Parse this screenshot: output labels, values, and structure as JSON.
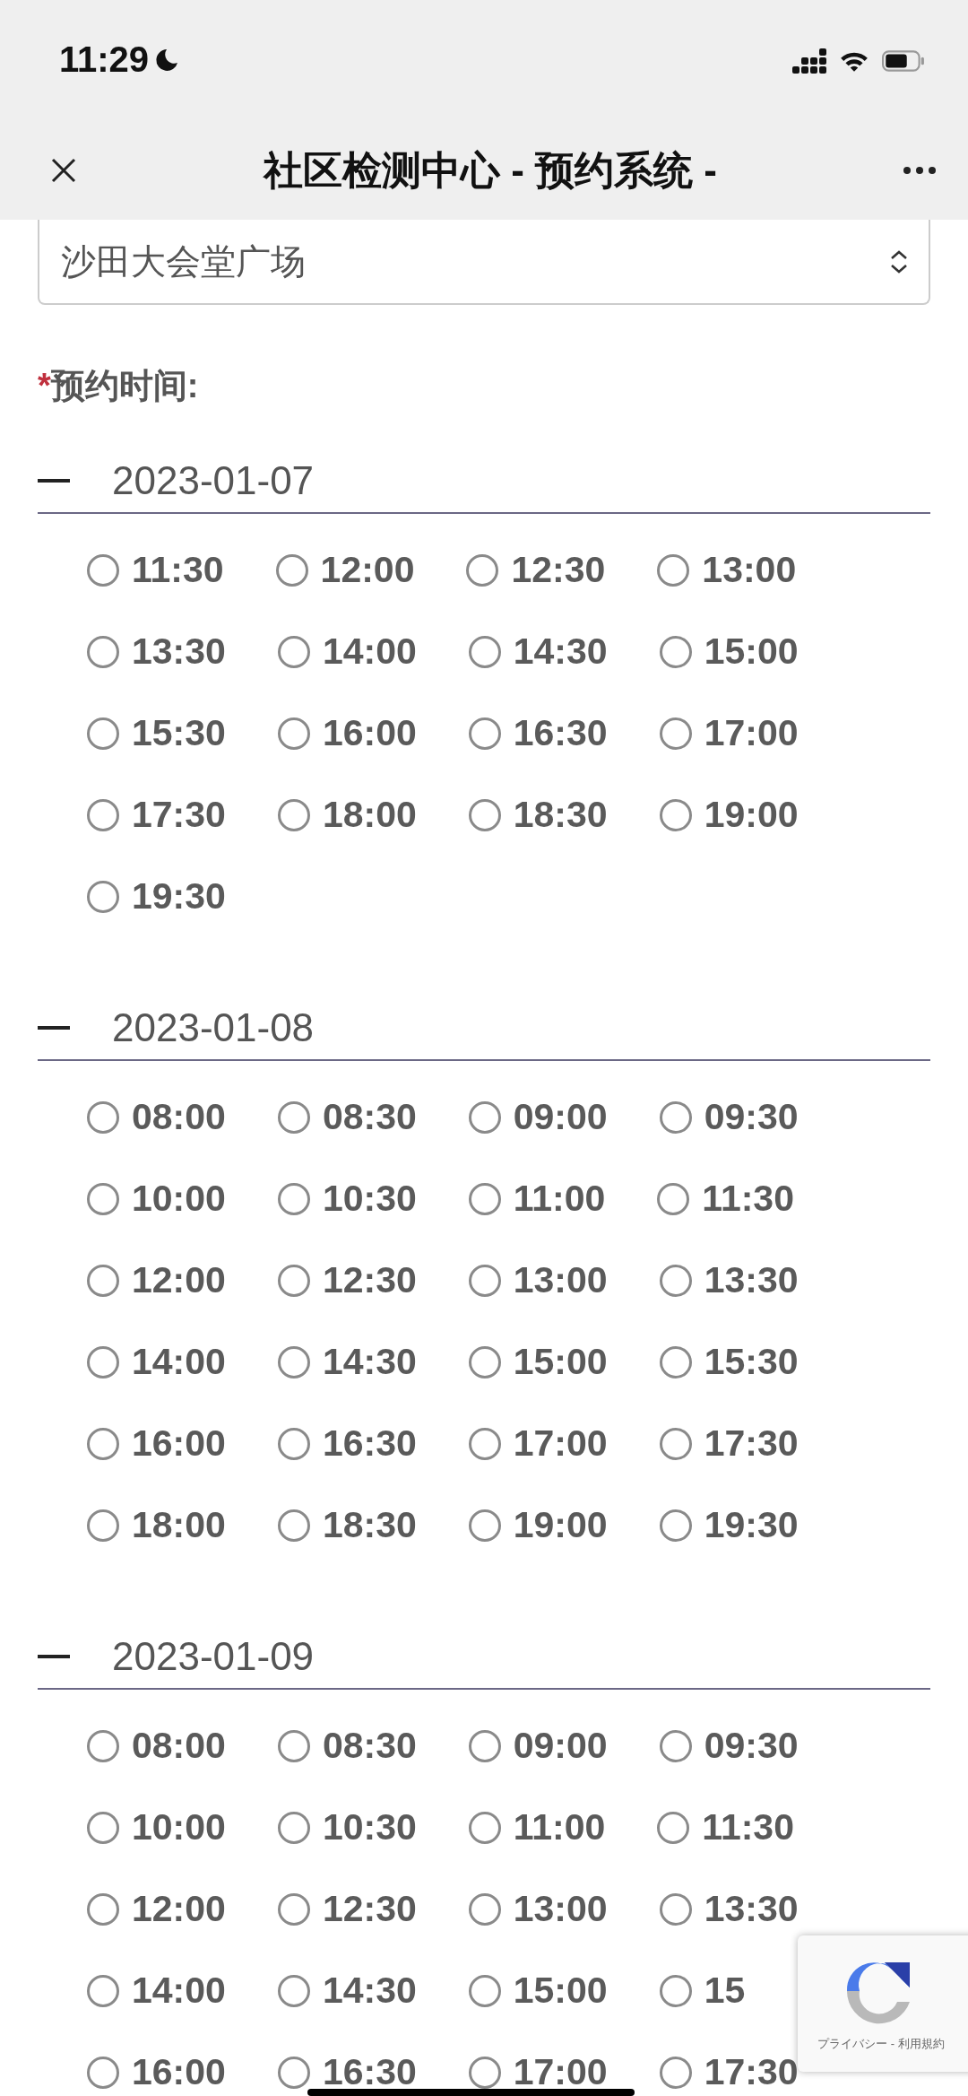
{
  "status_bar": {
    "time": "11:29"
  },
  "nav": {
    "title": "社区检测中心 - 预约系统 -"
  },
  "location_select": {
    "value": "沙田大会堂广场"
  },
  "time_label": {
    "required_mark": "*",
    "text": "预约时间:"
  },
  "days": [
    {
      "date": "2023-01-07",
      "expanded": true,
      "slots": [
        {
          "time": "11:30",
          "selected": false
        },
        {
          "time": "12:00",
          "selected": false
        },
        {
          "time": "12:30",
          "selected": false
        },
        {
          "time": "13:00",
          "selected": false
        },
        {
          "time": "13:30",
          "selected": false
        },
        {
          "time": "14:00",
          "selected": false
        },
        {
          "time": "14:30",
          "selected": false
        },
        {
          "time": "15:00",
          "selected": false
        },
        {
          "time": "15:30",
          "selected": false
        },
        {
          "time": "16:00",
          "selected": false
        },
        {
          "time": "16:30",
          "selected": false
        },
        {
          "time": "17:00",
          "selected": false
        },
        {
          "time": "17:30",
          "selected": false
        },
        {
          "time": "18:00",
          "selected": false
        },
        {
          "time": "18:30",
          "selected": false
        },
        {
          "time": "19:00",
          "selected": false
        },
        {
          "time": "19:30",
          "selected": false
        }
      ]
    },
    {
      "date": "2023-01-08",
      "expanded": true,
      "slots": [
        {
          "time": "08:00",
          "selected": false
        },
        {
          "time": "08:30",
          "selected": false
        },
        {
          "time": "09:00",
          "selected": false
        },
        {
          "time": "09:30",
          "selected": false
        },
        {
          "time": "10:00",
          "selected": false
        },
        {
          "time": "10:30",
          "selected": false
        },
        {
          "time": "11:00",
          "selected": false
        },
        {
          "time": "11:30",
          "selected": false
        },
        {
          "time": "12:00",
          "selected": false
        },
        {
          "time": "12:30",
          "selected": false
        },
        {
          "time": "13:00",
          "selected": false
        },
        {
          "time": "13:30",
          "selected": false
        },
        {
          "time": "14:00",
          "selected": false
        },
        {
          "time": "14:30",
          "selected": false
        },
        {
          "time": "15:00",
          "selected": false
        },
        {
          "time": "15:30",
          "selected": false
        },
        {
          "time": "16:00",
          "selected": false
        },
        {
          "time": "16:30",
          "selected": false
        },
        {
          "time": "17:00",
          "selected": false
        },
        {
          "time": "17:30",
          "selected": false
        },
        {
          "time": "18:00",
          "selected": false
        },
        {
          "time": "18:30",
          "selected": false
        },
        {
          "time": "19:00",
          "selected": false
        },
        {
          "time": "19:30",
          "selected": false
        }
      ]
    },
    {
      "date": "2023-01-09",
      "expanded": true,
      "slots": [
        {
          "time": "08:00",
          "selected": false
        },
        {
          "time": "08:30",
          "selected": false
        },
        {
          "time": "09:00",
          "selected": false
        },
        {
          "time": "09:30",
          "selected": false
        },
        {
          "time": "10:00",
          "selected": false
        },
        {
          "time": "10:30",
          "selected": false
        },
        {
          "time": "11:00",
          "selected": false
        },
        {
          "time": "11:30",
          "selected": false
        },
        {
          "time": "12:00",
          "selected": false
        },
        {
          "time": "12:30",
          "selected": false
        },
        {
          "time": "13:00",
          "selected": false
        },
        {
          "time": "13:30",
          "selected": false
        },
        {
          "time": "14:00",
          "selected": false
        },
        {
          "time": "14:30",
          "selected": false
        },
        {
          "time": "15:00",
          "selected": false
        },
        {
          "time": "15",
          "selected": false
        },
        {
          "time": "16:00",
          "selected": false
        },
        {
          "time": "16:30",
          "selected": false
        },
        {
          "time": "17:00",
          "selected": false
        },
        {
          "time": "17:30",
          "selected": false
        }
      ]
    }
  ],
  "recaptcha": {
    "links": "プライバシー - 利用規約"
  }
}
